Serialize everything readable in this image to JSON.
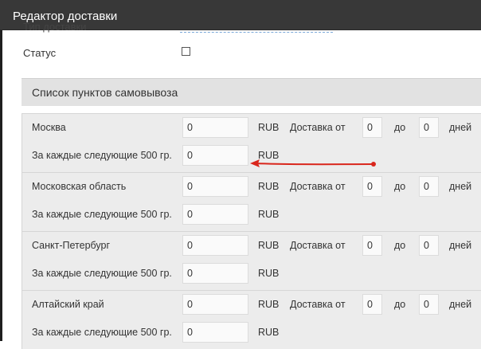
{
  "window": {
    "title": "Редактор доставки"
  },
  "form": {
    "cut_label": "Тип доставки",
    "status_label": "Статус",
    "status_checked": false
  },
  "panel": {
    "title": "Список пунктов самовывоза"
  },
  "labels": {
    "per_weight": "За каждые следующие 500 гр.",
    "currency": "RUB",
    "delivery_from": "Доставка от",
    "to": "до",
    "days": "дней"
  },
  "pickup_points": [
    {
      "region": "Москва",
      "price": "0",
      "extra_price": "0",
      "days_from": "0",
      "days_to": "0"
    },
    {
      "region": "Московская область",
      "price": "0",
      "extra_price": "0",
      "days_from": "0",
      "days_to": "0"
    },
    {
      "region": "Санкт-Петербург",
      "price": "0",
      "extra_price": "0",
      "days_from": "0",
      "days_to": "0"
    },
    {
      "region": "Алтайский край",
      "price": "0",
      "extra_price": "0",
      "days_from": "0",
      "days_to": "0"
    }
  ],
  "annotation": {
    "color": "#d9261c"
  }
}
